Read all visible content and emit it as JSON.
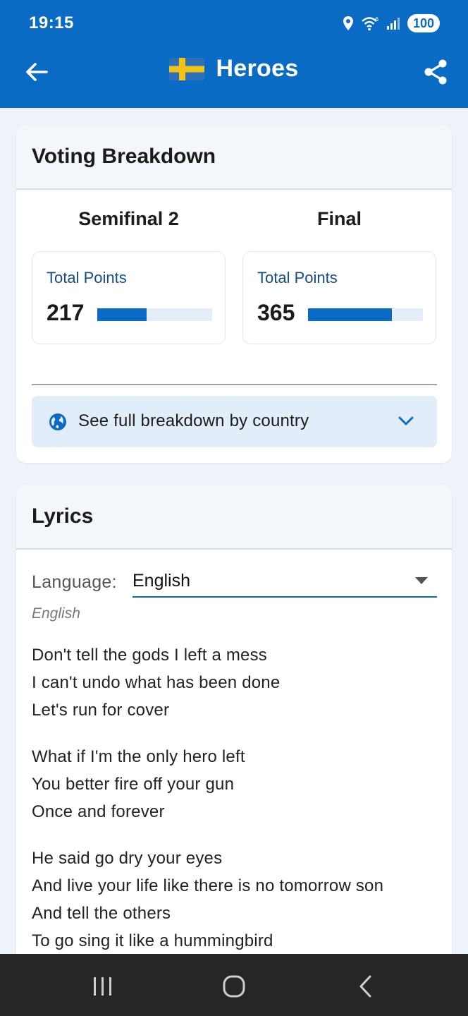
{
  "status_bar": {
    "time": "19:15",
    "battery": "100"
  },
  "header": {
    "flag": "Sweden",
    "title": "Heroes"
  },
  "voting": {
    "title": "Voting Breakdown",
    "stages": [
      {
        "name": "Semifinal 2",
        "points_label": "Total Points",
        "points": "217",
        "fill_fraction": 0.43
      },
      {
        "name": "Final",
        "points_label": "Total Points",
        "points": "365",
        "fill_fraction": 0.73
      }
    ],
    "breakdown_label": "See full breakdown by country"
  },
  "lyrics": {
    "title": "Lyrics",
    "language_label": "Language:",
    "language_value": "English",
    "language_caption": "English",
    "stanzas": [
      [
        "Don't tell the gods I left a mess",
        "I can't undo what has been done",
        "Let's run for cover"
      ],
      [
        "What if I'm the only hero left",
        "You better fire off your gun",
        "Once and forever"
      ],
      [
        "He said go dry your eyes",
        "And live your life like there is no tomorrow son",
        "And tell the others",
        "To go sing it like a hummingbird"
      ]
    ]
  },
  "colors": {
    "primary": "#0a6bc4",
    "bar_track": "#e4eef8",
    "label_blue": "#124f86"
  }
}
